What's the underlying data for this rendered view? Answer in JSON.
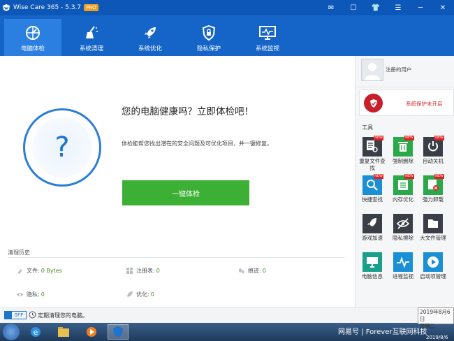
{
  "window": {
    "title": "Wise Care 365 - 5.3.7",
    "badge": "PRO"
  },
  "nav": {
    "items": [
      {
        "label": "电脑体检",
        "icon": "health-check-icon"
      },
      {
        "label": "系统清理",
        "icon": "broom-icon"
      },
      {
        "label": "系统优化",
        "icon": "rocket-icon"
      },
      {
        "label": "隐私保护",
        "icon": "lock-icon"
      },
      {
        "label": "系统监视",
        "icon": "monitor-icon"
      }
    ]
  },
  "main": {
    "headline": "您的电脑健康吗？立即体检吧！",
    "description": "体检能帮您找出潜在的安全问题及可优化项目，并一键修复。",
    "check_button": "一键体检",
    "question_mark": "?"
  },
  "history": {
    "title": "清理历史",
    "files_label": "文件:",
    "files_value": "0 Bytes",
    "registry_label": "注册表:",
    "registry_value": "0",
    "traces_label": "痕迹:",
    "traces_value": "0",
    "privacy_label": "隐私:",
    "privacy_value": "0",
    "optimize_label": "优化:",
    "optimize_value": "0"
  },
  "bottom": {
    "toggle_label": "OFF",
    "schedule_text": "定期清理您的电脑。"
  },
  "side": {
    "user_name": "注册的用户",
    "protection_status": "系统保护未开启",
    "tools_title": "工具",
    "tools": [
      {
        "label": "重复文件查找",
        "icon": "duplicate-file-icon",
        "color": "#3a3f47",
        "new": "NEW"
      },
      {
        "label": "强制删除",
        "icon": "trash-icon",
        "color": "#2aa84a",
        "new": "NEW"
      },
      {
        "label": "自动关机",
        "icon": "power-icon",
        "color": "#3a3f47",
        "new": "NEW"
      },
      {
        "label": "快捷查找",
        "icon": "search-icon",
        "color": "#1a8fd6",
        "new": "NEW"
      },
      {
        "label": "内存优化",
        "icon": "memory-icon",
        "color": "#2aa84a",
        "new": "NEW"
      },
      {
        "label": "强力卸载",
        "icon": "uninstall-icon",
        "color": "#2aa84a",
        "new": "NEW"
      },
      {
        "label": "游戏加速",
        "icon": "game-boost-icon",
        "color": "#3a3f47"
      },
      {
        "label": "隐私擦除",
        "icon": "eye-off-icon",
        "color": "#3a3f47"
      },
      {
        "label": "大文件管理",
        "icon": "folder-icon",
        "color": "#3a3f47"
      },
      {
        "label": "电脑信息",
        "icon": "pc-info-icon",
        "color": "#1aa08a"
      },
      {
        "label": "进程监视",
        "icon": "pulse-icon",
        "color": "#1a8fd6"
      },
      {
        "label": "启动项管理",
        "icon": "play-icon",
        "color": "#1a8fd6"
      }
    ]
  },
  "taskbar": {
    "date_popup_line1": "2019年8月6日",
    "date_popup_line2": "星期二",
    "watermark": "网易号 | Forever互联网科技",
    "tray_date": "2019/8/6"
  },
  "colors": {
    "titlebar": "#0d57b8",
    "navbar": "#1565c9",
    "nav_active": "#2a7fe0",
    "check_button": "#3cb034",
    "circle_blue": "#2b7fd6",
    "protect_red": "#c8202a"
  }
}
